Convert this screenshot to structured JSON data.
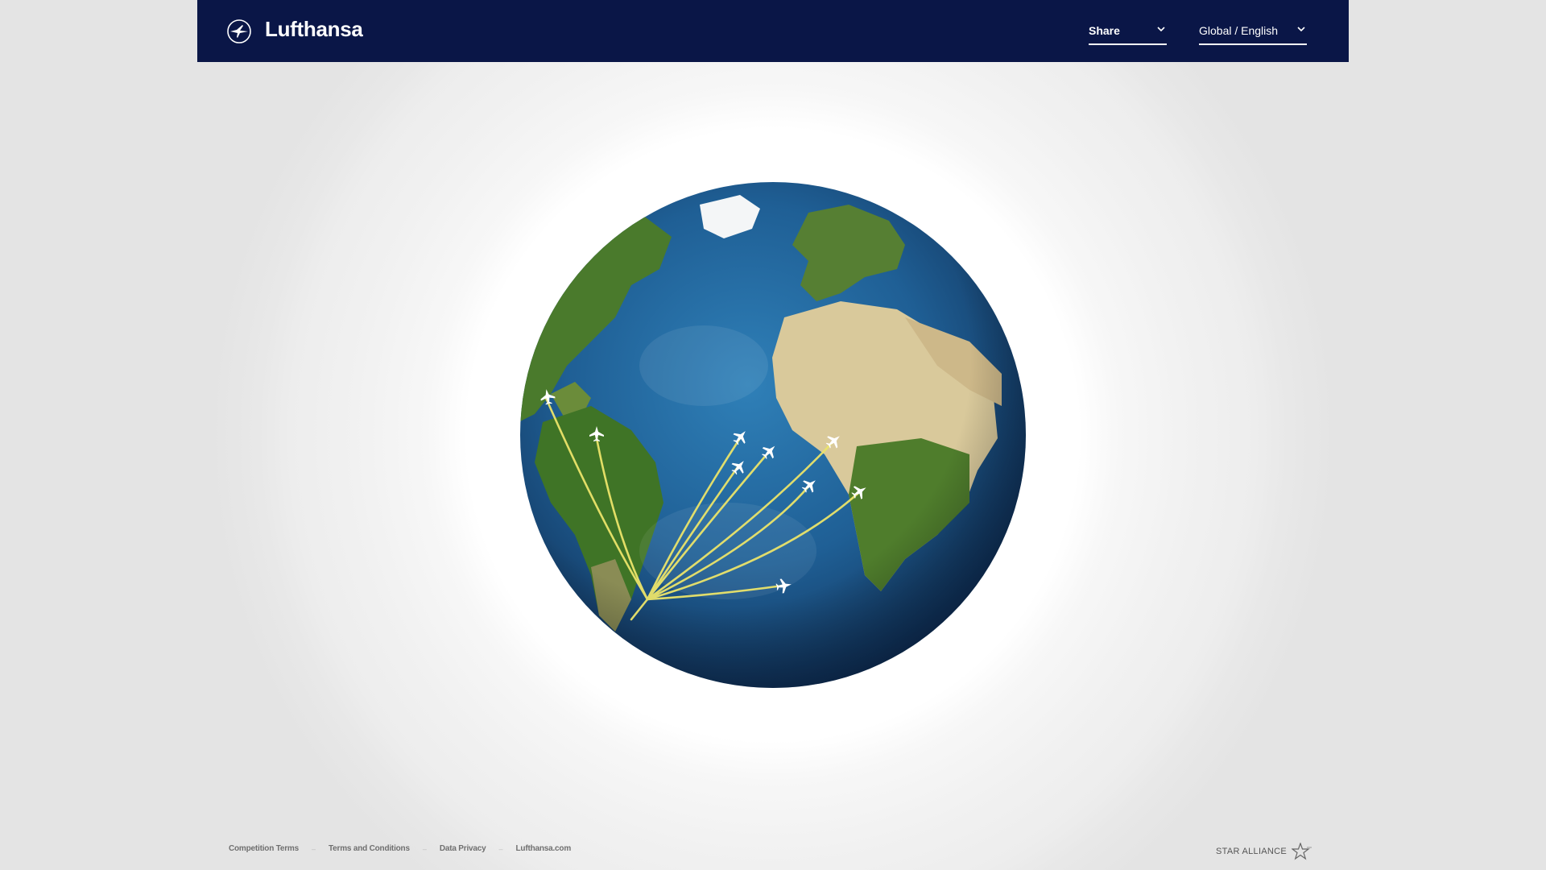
{
  "header": {
    "brand": "Lufthansa",
    "share_label": "Share",
    "language_label": "Global / English",
    "background": "#0a1647"
  },
  "globe": {
    "flight_paths": 10,
    "accent_color": "#e9e36a"
  },
  "footer": {
    "links": [
      "Competition Terms",
      "Terms and Conditions",
      "Data Privacy",
      "Lufthansa.com"
    ],
    "partner": "STAR ALLIANCE"
  }
}
